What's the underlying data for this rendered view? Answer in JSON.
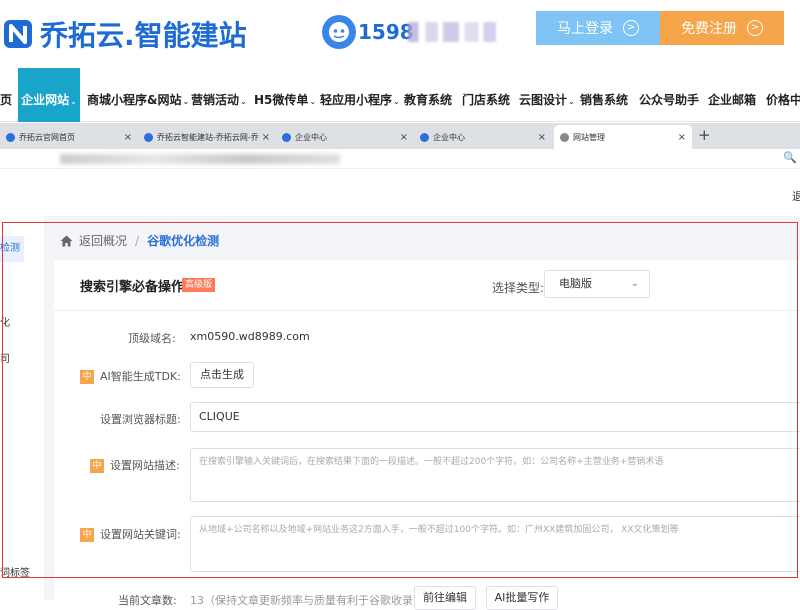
{
  "header": {
    "logo_text": "乔拓云.智能建站",
    "phone_prefix": "1598",
    "login_label": "马上登录",
    "register_label": "免费注册",
    "arrow_glyph": ">"
  },
  "nav": {
    "items": [
      "页",
      "企业网站",
      "商城小程序&网站",
      "营销活动",
      "H5微传单",
      "轻应用小程序",
      "教育系统",
      "门店系统",
      "云图设计",
      "销售系统",
      "公众号助手",
      "企业邮箱",
      "价格中心"
    ],
    "active_index": 1,
    "caret_glyph": "⌄"
  },
  "browser": {
    "tabs": [
      {
        "label": "乔拓云官网首页"
      },
      {
        "label": "乔拓云智能建站-乔拓云网-乔"
      },
      {
        "label": "企业中心"
      },
      {
        "label": "企业中心"
      },
      {
        "label": "网站管理"
      }
    ],
    "active_tab": 4,
    "close_glyph": "×",
    "plus_glyph": "+",
    "zoom_glyph": "🔍",
    "toolbar_char": "退"
  },
  "sidebar": {
    "active_label": "检测",
    "items": [
      "化",
      "司",
      "词标签"
    ]
  },
  "breadcrumb": {
    "back_label": "返回概况",
    "separator": "/",
    "current": "谷歌优化检测"
  },
  "panel": {
    "title": "搜索引擎必备操作",
    "badge": "高级版",
    "type_label": "选择类型:",
    "type_value": "电脑版",
    "chev_glyph": "⌄"
  },
  "form": {
    "domain_label": "顶级域名:",
    "domain_value": "xm0590.wd8989.com",
    "tag_zhong": "中",
    "ai_tdk_label": "AI智能生成TDK:",
    "ai_tdk_button": "点击生成",
    "title_label": "设置浏览器标题:",
    "title_value": "CLIQUE",
    "desc_label": "设置网站描述:",
    "desc_placeholder": "在搜索引擎输入关键词后，在搜索结果下面的一段描述。一般不超过200个字符。如：公司名称+主营业务+营销术语",
    "keywords_label": "设置网站关键词:",
    "keywords_placeholder": "从地域+公司名称以及地域+网站业务这2方面入手，一般不超过100个字符。如：广州XX建筑加固公司， XX文化策划等",
    "article_label": "当前文章数:",
    "article_value": "13（保持文章更新频率与质量有利于谷歌收录）",
    "article_btn1": "前往编辑",
    "article_btn2": "AI批量写作"
  },
  "colors": {
    "brand_blue": "#1e6bd6",
    "nav_active": "#19a4c9",
    "login_bg": "#7fc4f5",
    "register_bg": "#f6a54b",
    "highlight_red": "#e0393e"
  }
}
